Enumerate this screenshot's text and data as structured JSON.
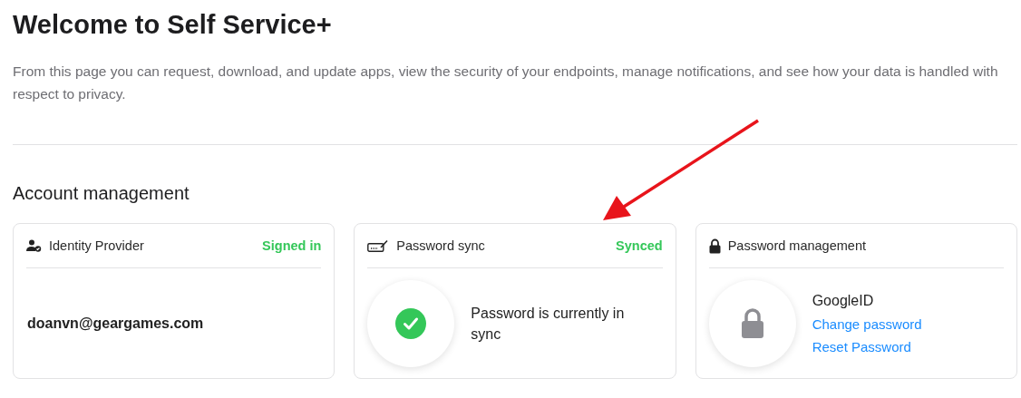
{
  "title": "Welcome to Self Service+",
  "description": "From this page you can request, download, and update apps, view the security of your endpoints, manage notifications, and see how your data is handled with respect to privacy.",
  "section": {
    "title": "Account management"
  },
  "cards": [
    {
      "kind": "identity",
      "title": "Identity Provider",
      "status": "Signed in",
      "email": "doanvn@geargames.com"
    },
    {
      "kind": "sync",
      "title": "Password sync",
      "status": "Synced",
      "message": "Password is currently in sync"
    },
    {
      "kind": "management",
      "title": "Password management",
      "provider": "GoogleID",
      "links": [
        "Change password",
        "Reset Password"
      ]
    }
  ]
}
